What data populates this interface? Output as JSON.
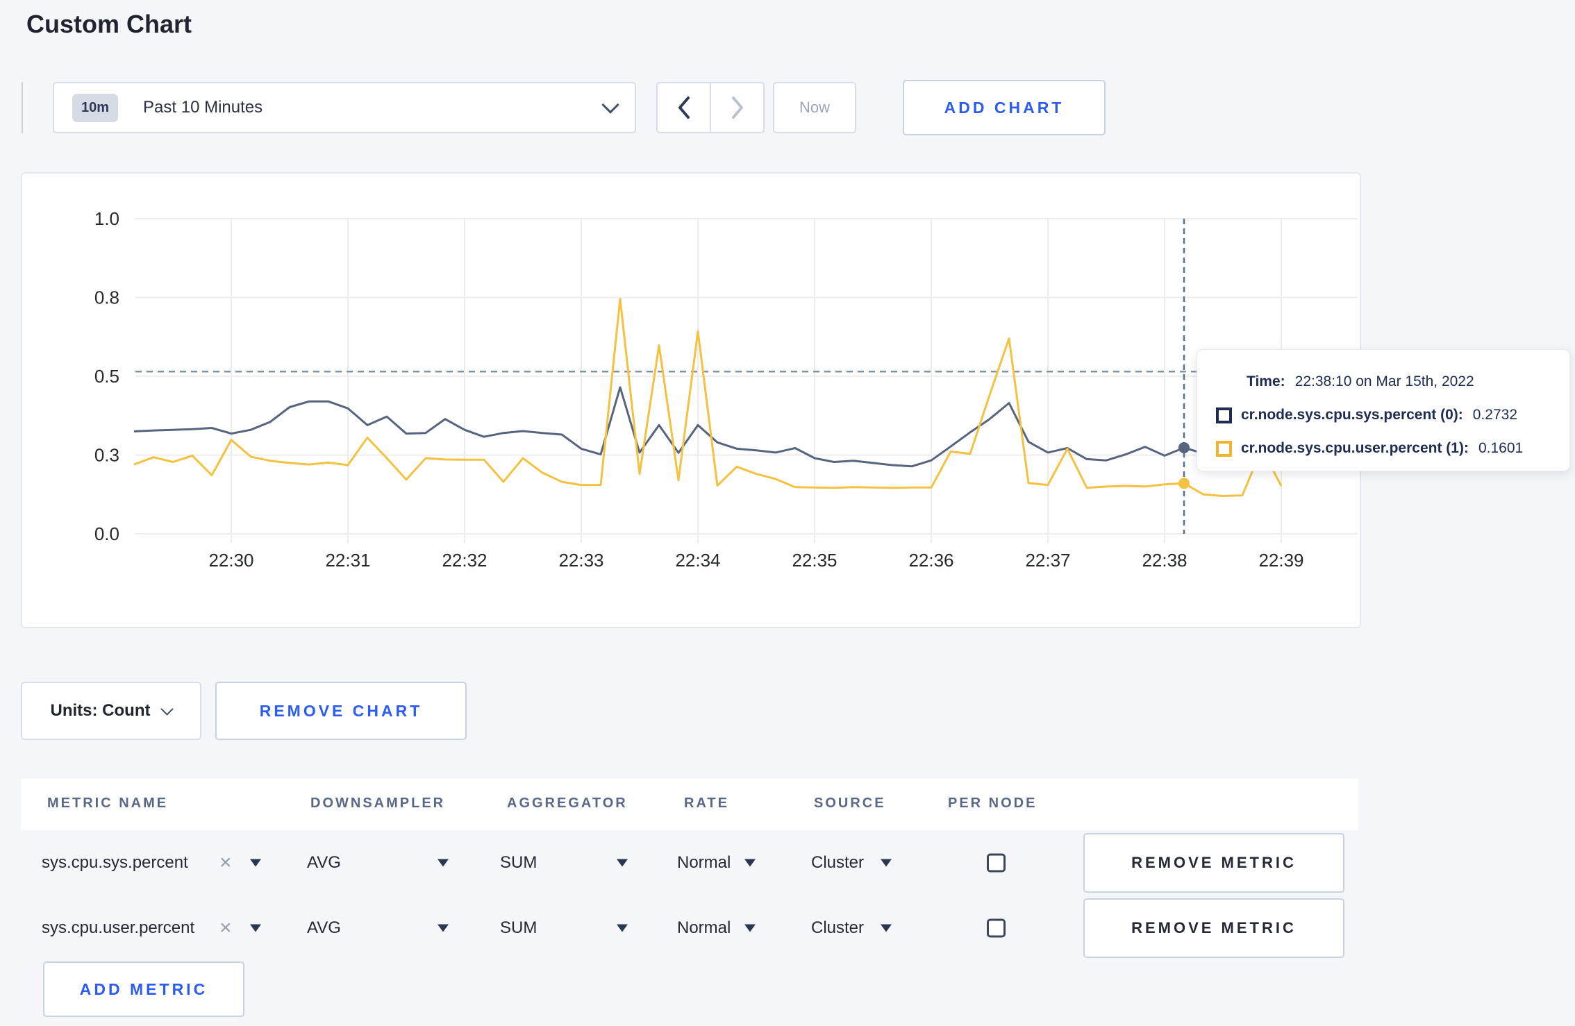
{
  "page": {
    "title": "Custom Chart"
  },
  "colors": {
    "accent_blue": "#2b5bf0",
    "series_sys": "#57647e",
    "series_user": "#f3c240",
    "grid": "#ececec",
    "guide_dash": "#7d92ac",
    "crosshair": "#54718f",
    "axis_text": "#26292e",
    "tooltip_sys_square": "#1d2c50",
    "tooltip_user_square": "#f0b52f"
  },
  "toolbar": {
    "range_badge": "10m",
    "range_label": "Past 10 Minutes",
    "prev_icon": "chevron-left",
    "next_icon": "chevron-right",
    "now_label": "Now",
    "add_chart_label": "ADD CHART"
  },
  "chart_data": {
    "type": "line",
    "title": "",
    "xlabel": "",
    "ylabel": "",
    "ylim": [
      0,
      1
    ],
    "grid": true,
    "y_ticks": [
      {
        "value": 0,
        "label": "0.0"
      },
      {
        "value": 0.25,
        "label": "0.3"
      },
      {
        "value": 0.5,
        "label": "0.5"
      },
      {
        "value": 0.75,
        "label": "0.8"
      },
      {
        "value": 1,
        "label": "1.0"
      }
    ],
    "x_ticks": [
      {
        "minute": 0,
        "label": "22:30"
      },
      {
        "minute": 1,
        "label": "22:31"
      },
      {
        "minute": 2,
        "label": "22:32"
      },
      {
        "minute": 3,
        "label": "22:33"
      },
      {
        "minute": 4,
        "label": "22:34"
      },
      {
        "minute": 5,
        "label": "22:35"
      },
      {
        "minute": 6,
        "label": "22:36"
      },
      {
        "minute": 7,
        "label": "22:37"
      },
      {
        "minute": 8,
        "label": "22:38"
      },
      {
        "minute": 9,
        "label": "22:39"
      }
    ],
    "x_start_minutes": -0.8333,
    "x_step_minutes": 0.16667,
    "guide_value": 0.515,
    "hover": {
      "x_minutes": 8.16667,
      "values": [
        0.2732,
        0.1601
      ]
    },
    "series": [
      {
        "name": "cr.node.sys.cpu.sys.percent",
        "color": "#57647e",
        "values": [
          0.325,
          0.328,
          0.33,
          0.332,
          0.336,
          0.318,
          0.33,
          0.355,
          0.402,
          0.42,
          0.42,
          0.398,
          0.345,
          0.372,
          0.318,
          0.32,
          0.364,
          0.33,
          0.308,
          0.32,
          0.326,
          0.32,
          0.315,
          0.27,
          0.252,
          0.465,
          0.258,
          0.345,
          0.257,
          0.345,
          0.29,
          0.27,
          0.265,
          0.258,
          0.272,
          0.24,
          0.228,
          0.232,
          0.225,
          0.218,
          0.214,
          0.233,
          0.277,
          0.322,
          0.364,
          0.415,
          0.292,
          0.258,
          0.272,
          0.237,
          0.233,
          0.252,
          0.276,
          0.248,
          0.2732,
          0.255,
          0.25,
          0.26,
          0.29,
          0.305
        ]
      },
      {
        "name": "cr.node.sys.cpu.user.percent",
        "color": "#f3c240",
        "values": [
          0.22,
          0.243,
          0.228,
          0.248,
          0.186,
          0.298,
          0.245,
          0.232,
          0.225,
          0.22,
          0.226,
          0.218,
          0.305,
          0.24,
          0.172,
          0.24,
          0.236,
          0.235,
          0.235,
          0.165,
          0.24,
          0.194,
          0.165,
          0.155,
          0.155,
          0.745,
          0.19,
          0.598,
          0.17,
          0.642,
          0.153,
          0.213,
          0.19,
          0.174,
          0.148,
          0.147,
          0.146,
          0.148,
          0.147,
          0.146,
          0.147,
          0.147,
          0.261,
          0.254,
          0.44,
          0.62,
          0.161,
          0.155,
          0.27,
          0.146,
          0.15,
          0.152,
          0.15,
          0.157,
          0.1601,
          0.125,
          0.12,
          0.122,
          0.27,
          0.152
        ]
      }
    ]
  },
  "tooltip": {
    "time_label": "Time:",
    "time_value": "22:38:10 on Mar 15th, 2022",
    "rows": [
      {
        "name": "cr.node.sys.cpu.sys.percent (0):",
        "value": "0.2732",
        "square_color": "#1d2c50"
      },
      {
        "name": "cr.node.sys.cpu.user.percent (1):",
        "value": "0.1601",
        "square_color": "#f0b52f"
      }
    ]
  },
  "chart_controls": {
    "units_label": "Units: Count",
    "remove_chart_label": "REMOVE CHART"
  },
  "metrics_table": {
    "headers": [
      "METRIC NAME",
      "DOWNSAMPLER",
      "AGGREGATOR",
      "RATE",
      "SOURCE",
      "PER NODE"
    ],
    "rows": [
      {
        "metric": "sys.cpu.sys.percent",
        "downsampler": "AVG",
        "aggregator": "SUM",
        "rate": "Normal",
        "source": "Cluster",
        "per_node_checked": false,
        "remove_label": "REMOVE METRIC"
      },
      {
        "metric": "sys.cpu.user.percent",
        "downsampler": "AVG",
        "aggregator": "SUM",
        "rate": "Normal",
        "source": "Cluster",
        "per_node_checked": false,
        "remove_label": "REMOVE METRIC"
      }
    ],
    "add_metric_label": "ADD METRIC"
  }
}
